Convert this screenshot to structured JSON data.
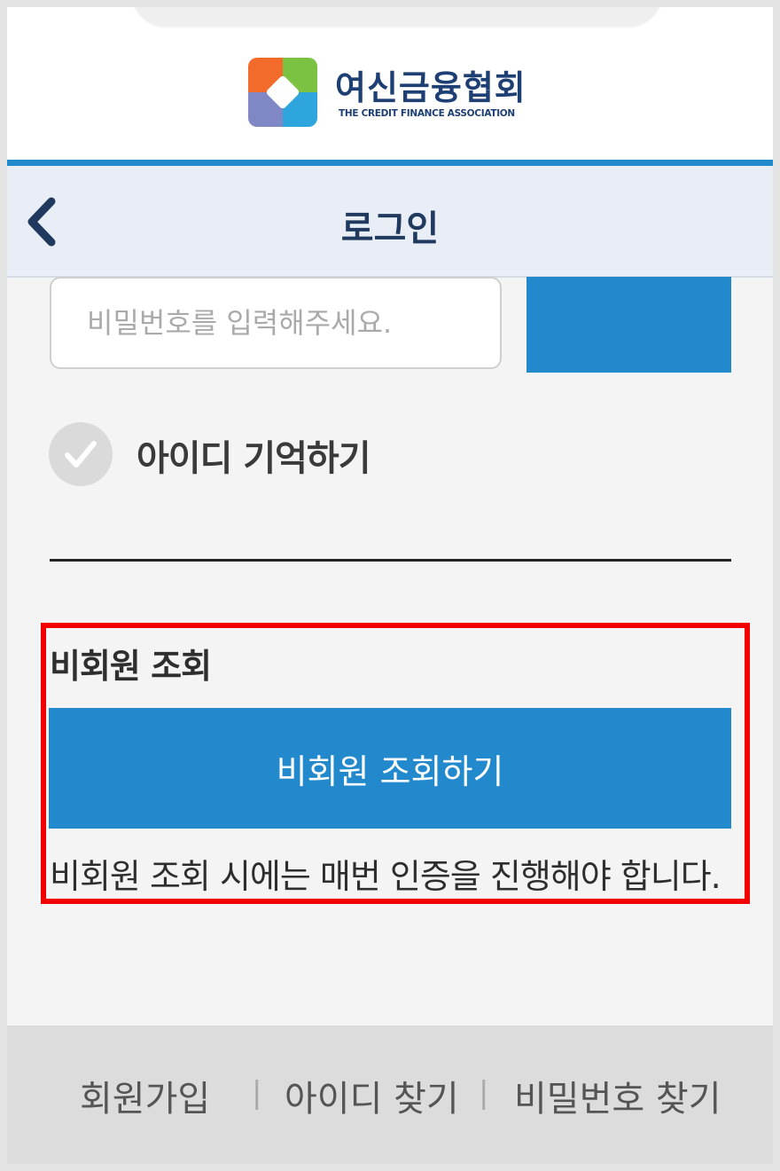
{
  "logo": {
    "title": "여신금융협회",
    "subtitle": "THE CREDIT FINANCE ASSOCIATION"
  },
  "header": {
    "title": "로그인",
    "back_icon": "chevron-left-icon"
  },
  "login": {
    "password_placeholder": "비밀번호를 입력해주세요.",
    "remember_label": "아이디 기억하기",
    "remember_icon": "checkmark-icon"
  },
  "guest": {
    "title": "비회원 조회",
    "button_label": "비회원 조회하기",
    "note": "비회원 조회 시에는 매번 인증을 진행해야 합니다."
  },
  "footer": {
    "signup": "회원가입",
    "find_id": "아이디 찾기",
    "find_password": "비밀번호 찾기",
    "separator": "|"
  },
  "colors": {
    "brand_blue": "#2389cd",
    "navy": "#1f3a5e",
    "highlight_red": "#f20000"
  }
}
